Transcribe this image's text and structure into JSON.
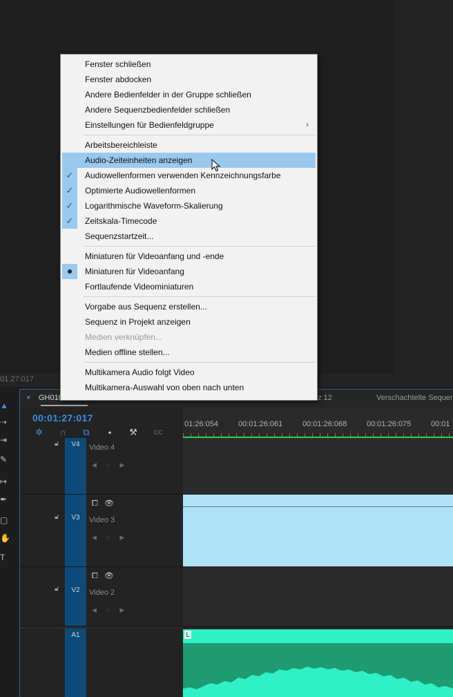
{
  "upper_panel": {
    "timecode": "01:27:017"
  },
  "tools": [
    "selection-tool",
    "track-select-tool",
    "ripple-edit-tool",
    "razor-tool",
    "slip-tool",
    "pen-tool",
    "rectangle-tool",
    "hand-tool",
    "type-tool"
  ],
  "timeline": {
    "tab_close": "×",
    "tab_active": "GH010",
    "tab_2": "nz 12",
    "tab_3": "Verschachtelte Sequen",
    "timecode": "00:01:27:017",
    "ruler_labels": [
      "01:26:054",
      "00:01:26:061",
      "00:01:26:068",
      "00:01:26:075",
      "00:01"
    ],
    "tracks": [
      {
        "id": "V4",
        "name": "Video 4"
      },
      {
        "id": "V3",
        "name": "Video 3"
      },
      {
        "id": "V2",
        "name": "Video 2"
      },
      {
        "id": "A1",
        "name": ""
      }
    ],
    "audio_clip_label": "L",
    "cc_label": "CC"
  },
  "menu": {
    "items": [
      {
        "label": "Fenster schließen"
      },
      {
        "label": "Fenster abdocken"
      },
      {
        "label": "Andere Bedienfelder in der Gruppe schließen"
      },
      {
        "label": "Andere Sequenzbedienfelder schließen"
      },
      {
        "label": "Einstellungen für Bedienfeldgruppe",
        "submenu": true
      },
      {
        "label": "Arbeitsbereichleiste"
      },
      {
        "label": "Audio-Zeiteinheiten anzeigen",
        "highlighted": true
      },
      {
        "label": "Audiowellenformen verwenden Kennzeichnungsfarbe",
        "checked": true
      },
      {
        "label": "Optimierte Audiowellenformen",
        "checked": true
      },
      {
        "label": "Logarithmische Waveform-Skalierung",
        "checked": true
      },
      {
        "label": "Zeitskala-Timecode",
        "checked": true
      },
      {
        "label": "Sequenzstartzeit..."
      },
      {
        "label": "Miniaturen für Videoanfang und -ende"
      },
      {
        "label": "Miniaturen für Videoanfang",
        "selected": true
      },
      {
        "label": "Fortlaufende Videominiaturen"
      },
      {
        "label": "Vorgabe aus Sequenz erstellen..."
      },
      {
        "label": "Sequenz in Projekt anzeigen"
      },
      {
        "label": "Medien verknüpfen...",
        "disabled": true
      },
      {
        "label": "Medien offline stellen..."
      },
      {
        "label": "Multikamera Audio folgt Video"
      },
      {
        "label": "Multikamera-Auswahl von oben nach unten"
      }
    ],
    "submenu_arrow": "›",
    "check_glyph": "✓"
  },
  "colors": {
    "highlight": "#99c9ef",
    "timecode_blue": "#3a8ee6",
    "playhead_green": "#2fd24e",
    "audio_clip": "#1e9b70",
    "video_clip": "#aee3f7"
  }
}
